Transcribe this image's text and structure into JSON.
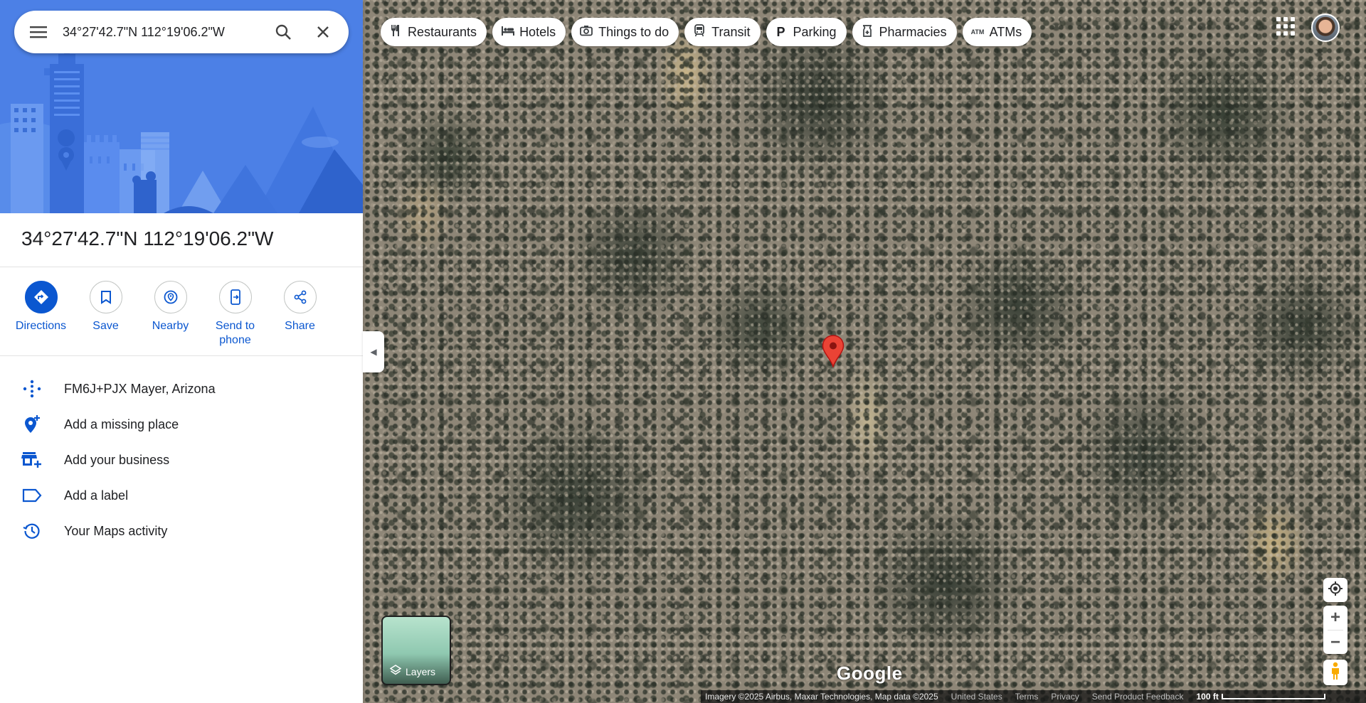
{
  "search": {
    "value": "34°27'42.7\"N 112°19'06.2\"W",
    "placeholder": "Search Google Maps"
  },
  "place": {
    "title": "34°27'42.7\"N 112°19'06.2\"W"
  },
  "actions": [
    {
      "label": "Directions",
      "icon": "directions-icon"
    },
    {
      "label": "Save",
      "icon": "bookmark-icon"
    },
    {
      "label": "Nearby",
      "icon": "nearby-icon"
    },
    {
      "label": "Send to phone",
      "icon": "send-to-phone-icon"
    },
    {
      "label": "Share",
      "icon": "share-icon"
    }
  ],
  "list": [
    {
      "text": "FM6J+PJX Mayer, Arizona",
      "icon": "plus-code-icon"
    },
    {
      "text": "Add a missing place",
      "icon": "add-place-icon"
    },
    {
      "text": "Add your business",
      "icon": "add-business-icon"
    },
    {
      "text": "Add a label",
      "icon": "label-icon"
    },
    {
      "text": "Your Maps activity",
      "icon": "history-icon"
    }
  ],
  "chips": [
    {
      "label": "Restaurants",
      "icon": "restaurant-icon"
    },
    {
      "label": "Hotels",
      "icon": "hotel-icon"
    },
    {
      "label": "Things to do",
      "icon": "camera-icon"
    },
    {
      "label": "Transit",
      "icon": "transit-icon"
    },
    {
      "label": "Parking",
      "icon": "parking-icon"
    },
    {
      "label": "Pharmacies",
      "icon": "pharmacy-icon"
    },
    {
      "label": "ATMs",
      "icon": "atm-icon"
    }
  ],
  "map": {
    "layers_label": "Layers",
    "logo": "Google",
    "attribution": "Imagery ©2025 Airbus, Maxar Technologies, Map data ©2025",
    "links": [
      "United States",
      "Terms",
      "Privacy",
      "Send Product Feedback"
    ],
    "scale_label": "100 ft"
  },
  "colors": {
    "accent": "#0b57d0",
    "hero_bg": "#4c80e6",
    "pin": "#ea4335"
  }
}
